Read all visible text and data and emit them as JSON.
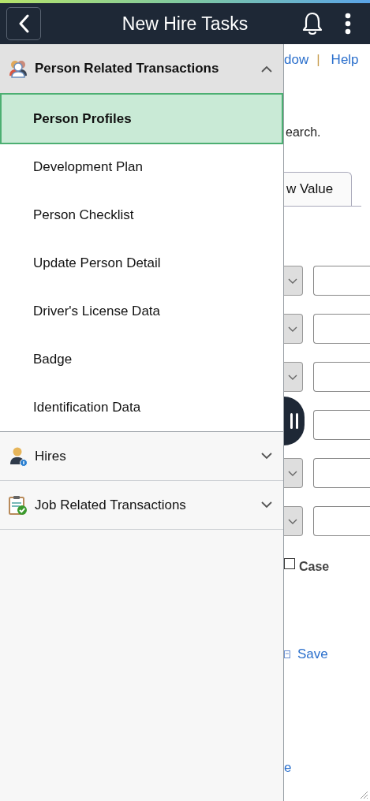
{
  "header": {
    "title": "New Hire Tasks"
  },
  "sections": [
    {
      "label": "Person Related Transactions",
      "kind": "people",
      "expanded": true,
      "items": [
        {
          "label": "Person Profiles",
          "selected": true
        },
        {
          "label": "Development Plan",
          "selected": false
        },
        {
          "label": "Person Checklist",
          "selected": false
        },
        {
          "label": "Update Person Detail",
          "selected": false
        },
        {
          "label": "Driver's License Data",
          "selected": false
        },
        {
          "label": "Badge",
          "selected": false
        },
        {
          "label": "Identification Data",
          "selected": false
        }
      ]
    },
    {
      "label": "Hires",
      "kind": "person",
      "expanded": false
    },
    {
      "label": "Job Related Transactions",
      "kind": "clipboard",
      "expanded": false
    }
  ],
  "background_page": {
    "links": [
      "dow",
      "Help"
    ],
    "separator": "|",
    "instruction": "earch.",
    "tab": "w Value",
    "case_checkbox": {
      "label": "Case",
      "checked": false
    },
    "save_link": "Save",
    "bottom_link": "e"
  }
}
